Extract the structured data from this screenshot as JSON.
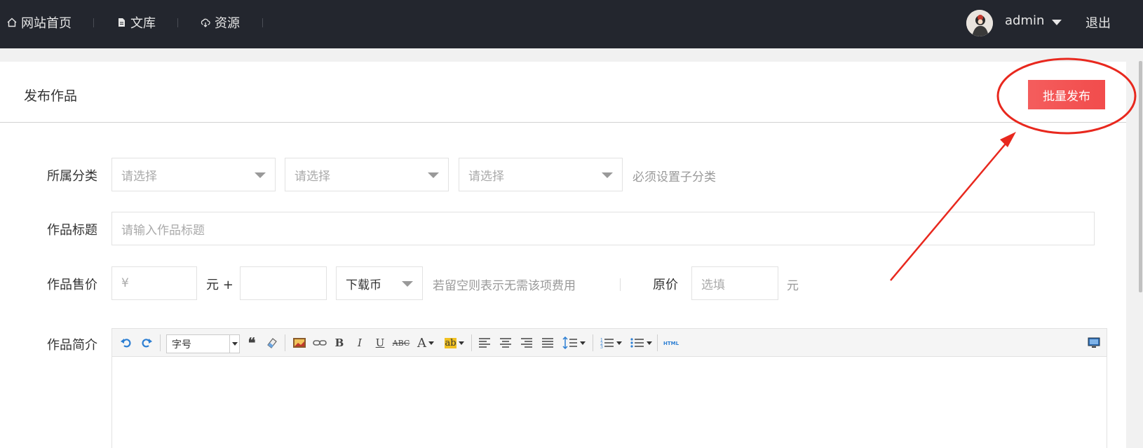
{
  "topnav": {
    "items": [
      {
        "label": "网站首页",
        "icon": "home-icon"
      },
      {
        "label": "文库",
        "icon": "document-icon"
      },
      {
        "label": "资源",
        "icon": "cloud-download-icon"
      }
    ],
    "user": "admin",
    "logout": "退出"
  },
  "page": {
    "title": "发布作品",
    "batch_button": "批量发布"
  },
  "form": {
    "category": {
      "label": "所属分类",
      "selects": [
        "请选择",
        "请选择",
        "请选择"
      ],
      "hint": "必须设置子分类"
    },
    "title": {
      "label": "作品标题",
      "placeholder": "请输入作品标题"
    },
    "price": {
      "label": "作品售价",
      "yen_placeholder": "¥",
      "unit_plus": "元 +",
      "currency": "下载币",
      "hint": "若留空则表示无需该项费用",
      "original_label": "原价",
      "original_placeholder": "选填",
      "original_unit": "元"
    },
    "intro": {
      "label": "作品简介",
      "font_size": "字号"
    }
  },
  "colors": {
    "topbar": "#23262e",
    "accent_button": "#f24c4c",
    "annotation": "#e8281e"
  }
}
